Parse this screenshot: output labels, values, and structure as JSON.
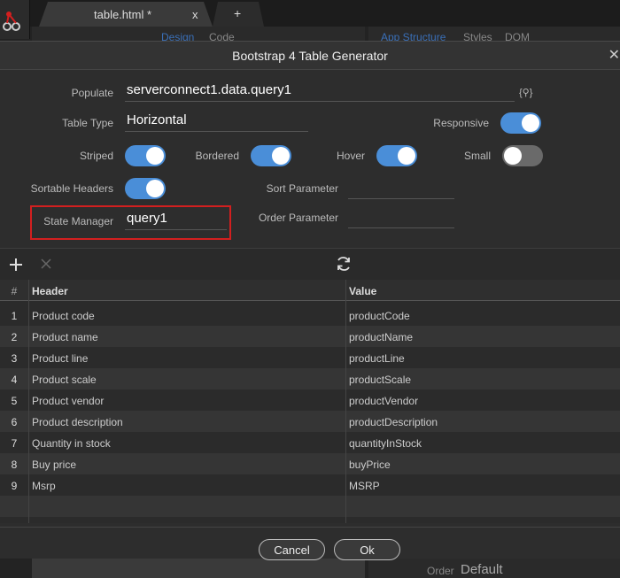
{
  "editor": {
    "tabs": [
      {
        "label": "table.html *",
        "close": "x"
      },
      {
        "label": "+"
      }
    ],
    "view_tabs_left": [
      "Design",
      "Code"
    ],
    "view_tabs_right": [
      "App Structure",
      "Styles",
      "DOM"
    ],
    "bg_order_label": "Order",
    "bg_order_value": "Default"
  },
  "dialog": {
    "title": "Bootstrap 4 Table Generator",
    "close": "✕",
    "populate": {
      "label": "Populate",
      "value": "serverconnect1.data.query1",
      "icon_text": "{⚲}"
    },
    "table_type": {
      "label": "Table Type",
      "value": "Horizontal"
    },
    "responsive": {
      "label": "Responsive",
      "on": true
    },
    "striped": {
      "label": "Striped",
      "on": true
    },
    "bordered": {
      "label": "Bordered",
      "on": true
    },
    "hover": {
      "label": "Hover",
      "on": true
    },
    "small": {
      "label": "Small",
      "on": false
    },
    "sortable_headers": {
      "label": "Sortable Headers",
      "on": true
    },
    "sort_parameter": {
      "label": "Sort Parameter",
      "value": ""
    },
    "state_manager": {
      "label": "State Manager",
      "value": "query1"
    },
    "order_parameter": {
      "label": "Order Parameter",
      "value": ""
    },
    "grid": {
      "columns": [
        "#",
        "Header",
        "Value"
      ],
      "rows": [
        {
          "num": "1",
          "header": "Product code",
          "value": "productCode"
        },
        {
          "num": "2",
          "header": "Product name",
          "value": "productName"
        },
        {
          "num": "3",
          "header": "Product line",
          "value": "productLine"
        },
        {
          "num": "4",
          "header": "Product scale",
          "value": "productScale"
        },
        {
          "num": "5",
          "header": "Product vendor",
          "value": "productVendor"
        },
        {
          "num": "6",
          "header": "Product description",
          "value": "productDescription"
        },
        {
          "num": "7",
          "header": "Quantity in stock",
          "value": "quantityInStock"
        },
        {
          "num": "8",
          "header": "Buy price",
          "value": "buyPrice"
        },
        {
          "num": "9",
          "header": "Msrp",
          "value": "MSRP"
        }
      ]
    },
    "buttons": {
      "cancel": "Cancel",
      "ok": "Ok"
    },
    "colors": {
      "accent": "#4a8ed8",
      "highlight": "#d31f1f"
    }
  }
}
